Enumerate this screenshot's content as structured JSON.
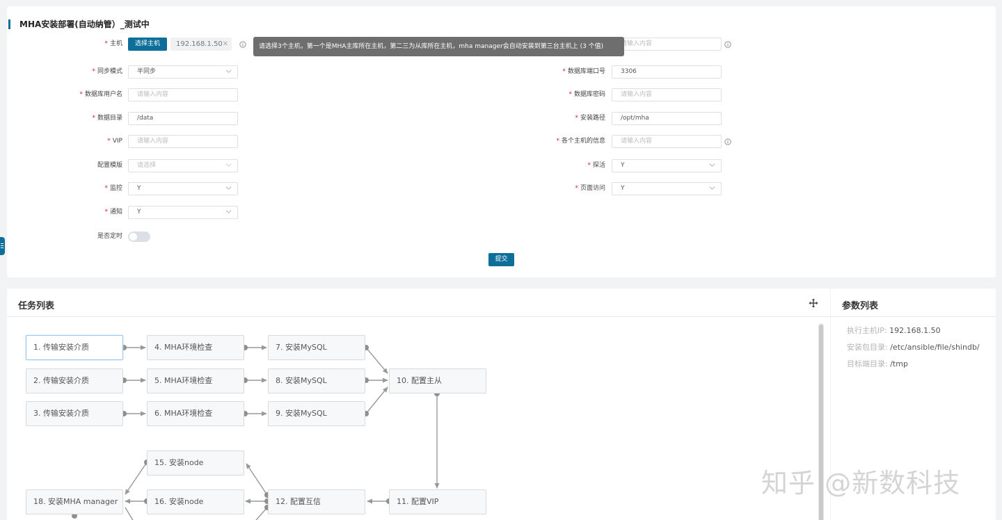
{
  "form": {
    "title": "MHA安装部署(自动纳管）_测试中",
    "host": {
      "label": "主机",
      "select_button": "选择主机",
      "tag": "192.168.1.50"
    },
    "tooltip": "请选择3个主机，第一个是MHA主库所在主机，第二三为从库所在主机，mha manager会自动安装到第三台主机上 (3 个值)",
    "right_top": {
      "value": "请输入内容"
    },
    "sync_mode": {
      "label": "同步模式",
      "value": "半同步"
    },
    "db_port": {
      "label": "数据库端口号",
      "value": "3306"
    },
    "db_user": {
      "label": "数据库用户名",
      "placeholder": "请输入内容"
    },
    "db_password": {
      "label": "数据库密码",
      "placeholder": "请输入内容"
    },
    "data_dir": {
      "label": "数据目录",
      "value": "/data"
    },
    "install_path": {
      "label": "安装路径",
      "value": "/opt/mha"
    },
    "vip": {
      "label": "VIP",
      "placeholder": "请输入内容"
    },
    "host_info": {
      "label": "各个主机的信息",
      "placeholder": "请输入内容"
    },
    "config_template": {
      "label": "配置模版",
      "placeholder": "请选择"
    },
    "probe": {
      "label": "探活",
      "value": "Y"
    },
    "monitor": {
      "label": "监控",
      "value": "Y"
    },
    "page_access": {
      "label": "页面访问",
      "value": "Y"
    },
    "notify": {
      "label": "通知",
      "value": "Y"
    },
    "scheduled": {
      "label": "是否定时",
      "on": false
    },
    "submit": "提交"
  },
  "tasks": {
    "title": "任务列表",
    "nodes": [
      "1. 传输安装介质",
      "2. 传输安装介质",
      "3. 传输安装介质",
      "4. MHA环境检查",
      "5. MHA环境检查",
      "6. MHA环境检查",
      "7. 安装MySQL",
      "8. 安装MySQL",
      "9. 安装MySQL",
      "10. 配置主从",
      "11. 配置VIP",
      "12. 配置互信",
      "15. 安装node",
      "16. 安装node",
      "18. 安装MHA manager"
    ]
  },
  "params": {
    "title": "参数列表",
    "rows": [
      {
        "key": "执行主机IP:",
        "value": "192.168.1.50"
      },
      {
        "key": "安装包目录:",
        "value": "/etc/ansible/file/shindb/"
      },
      {
        "key": "目标端目录:",
        "value": "/tmp"
      }
    ]
  },
  "watermark": "知乎 @新数科技"
}
